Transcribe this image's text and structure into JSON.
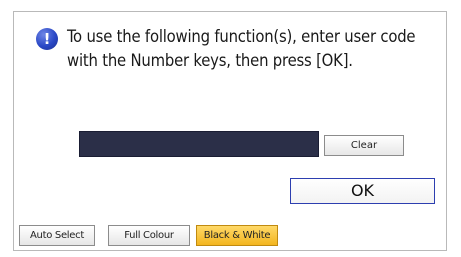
{
  "dialog": {
    "icon": "info-icon",
    "message": "To use the following function(s), enter user code with the Number keys, then press [OK].",
    "clear_label": "Clear",
    "ok_label": "OK",
    "code_value": ""
  },
  "colour_modes": [
    {
      "label": "Auto Select",
      "selected": false
    },
    {
      "label": "Full Colour",
      "selected": false
    },
    {
      "label": "Black & White",
      "selected": true
    }
  ],
  "colors": {
    "info_icon": "#2a48c6",
    "code_field": "#2b2f48",
    "ok_border": "#2d3fb0",
    "selected_mode": "#f3b51f"
  }
}
